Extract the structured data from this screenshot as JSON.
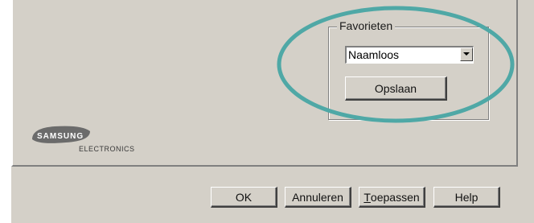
{
  "favorites": {
    "legend": "Favorieten",
    "selected": "Naamloos",
    "save_label": "Opslaan"
  },
  "branding": {
    "brand": "SAMSUNG",
    "sub": "ELECTRONICS"
  },
  "buttons": {
    "ok": "OK",
    "cancel": "Annuleren",
    "apply_mnemonic": "T",
    "apply_rest": "oepassen",
    "help": "Help"
  },
  "colors": {
    "highlight_ellipse": "#4fa8a6",
    "dialog_bg": "#d4d0c8"
  },
  "icons": {
    "dropdown": "chevron-down-icon"
  }
}
